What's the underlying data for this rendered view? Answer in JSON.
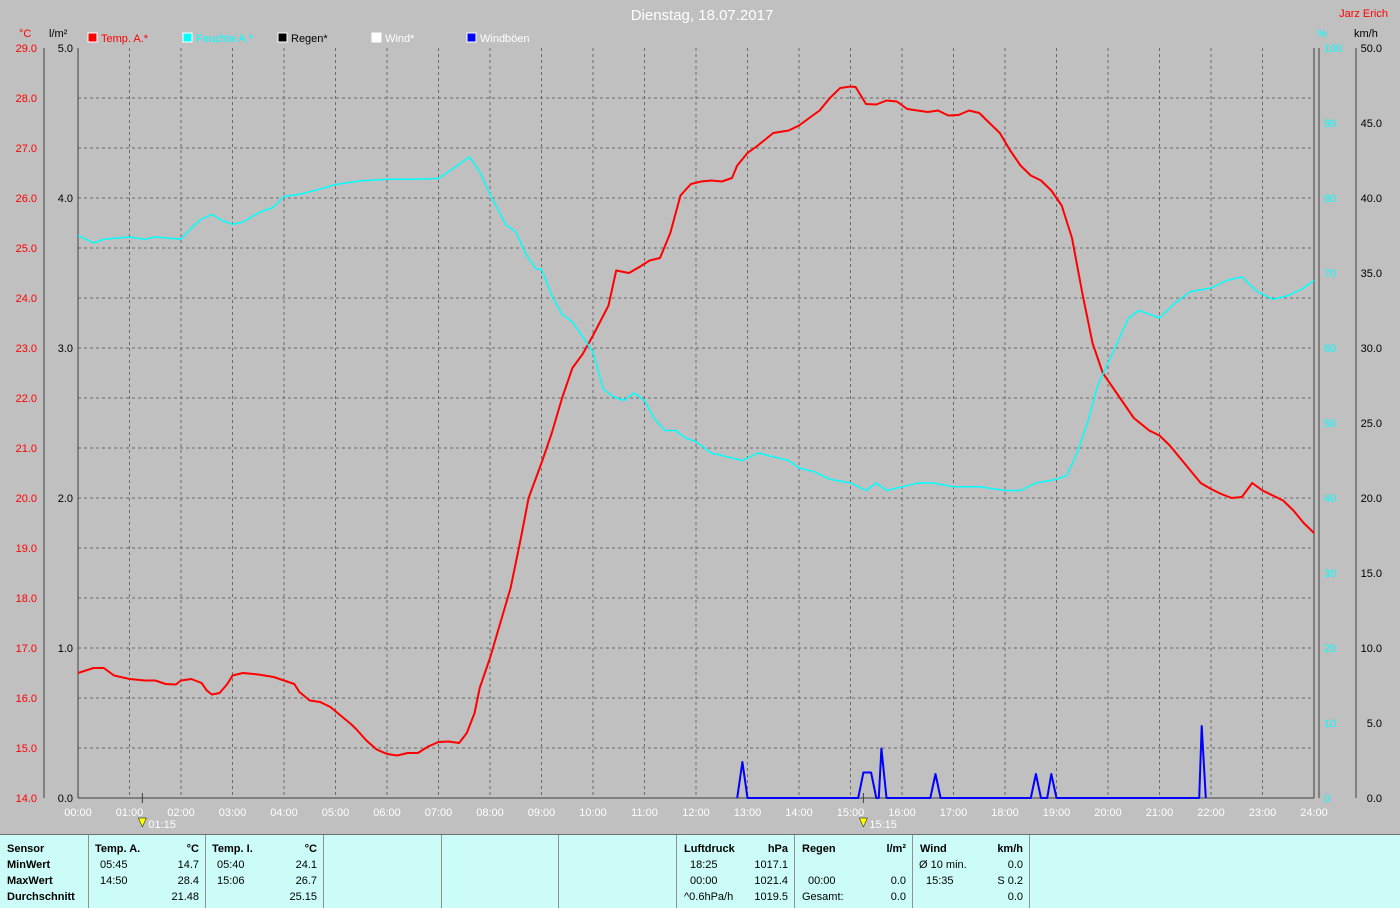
{
  "title": "Dienstag, 18.07.2017",
  "author": "Jarz Erich",
  "unit_labels": {
    "temp": "°C",
    "rain": "l/m²",
    "humidity": "%",
    "wind": "km/h"
  },
  "colors": {
    "temp": "#ff0000",
    "humidity": "#00ffff",
    "rain": "#000000",
    "wind": "#ffffff",
    "gust": "#0000ff"
  },
  "markers": [
    {
      "time": "01:15",
      "icon": "sun-icon"
    },
    {
      "time": "15:15",
      "icon": "sun-icon"
    }
  ],
  "chart_data": {
    "type": "line",
    "title": "Dienstag, 18.07.2017",
    "legend_position": "top",
    "grid": true,
    "x_ticks": [
      "00:00",
      "01:00",
      "02:00",
      "03:00",
      "04:00",
      "05:00",
      "06:00",
      "07:00",
      "08:00",
      "09:00",
      "10:00",
      "11:00",
      "12:00",
      "13:00",
      "14:00",
      "15:00",
      "16:00",
      "17:00",
      "18:00",
      "19:00",
      "20:00",
      "21:00",
      "22:00",
      "23:00",
      "24:00"
    ],
    "x_range_hours": [
      0,
      24
    ],
    "axes": {
      "temp": {
        "label": "°C",
        "range": [
          14.0,
          29.0
        ],
        "ticks": [
          "14.0",
          "15.0",
          "16.0",
          "17.0",
          "18.0",
          "19.0",
          "20.0",
          "21.0",
          "22.0",
          "23.0",
          "24.0",
          "25.0",
          "26.0",
          "27.0",
          "28.0",
          "29.0"
        ]
      },
      "rain": {
        "label": "l/m²",
        "range": [
          0.0,
          5.0
        ],
        "ticks": [
          "0.0",
          "1.0",
          "2.0",
          "3.0",
          "4.0",
          "5.0"
        ]
      },
      "humidity": {
        "label": "%",
        "range": [
          0,
          100
        ],
        "ticks": [
          "0",
          "10",
          "20",
          "30",
          "40",
          "50",
          "60",
          "70",
          "80",
          "90",
          "100"
        ]
      },
      "wind": {
        "label": "km/h",
        "range": [
          0.0,
          50.0
        ],
        "ticks": [
          "0.0",
          "5.0",
          "10.0",
          "15.0",
          "20.0",
          "25.0",
          "30.0",
          "35.0",
          "40.0",
          "45.0",
          "50.0"
        ]
      }
    },
    "series": [
      {
        "name": "Temp. A.*",
        "axis": "temp",
        "points": [
          [
            0,
            16.5
          ],
          [
            0.3,
            16.6
          ],
          [
            0.5,
            16.6
          ],
          [
            0.7,
            16.45
          ],
          [
            1,
            16.38
          ],
          [
            1.3,
            16.35
          ],
          [
            1.5,
            16.35
          ],
          [
            1.7,
            16.28
          ],
          [
            1.9,
            16.27
          ],
          [
            2,
            16.35
          ],
          [
            2.2,
            16.38
          ],
          [
            2.4,
            16.3
          ],
          [
            2.5,
            16.15
          ],
          [
            2.6,
            16.07
          ],
          [
            2.75,
            16.1
          ],
          [
            2.9,
            16.28
          ],
          [
            3,
            16.45
          ],
          [
            3.2,
            16.5
          ],
          [
            3.5,
            16.47
          ],
          [
            3.8,
            16.42
          ],
          [
            4,
            16.35
          ],
          [
            4.2,
            16.28
          ],
          [
            4.3,
            16.12
          ],
          [
            4.5,
            15.95
          ],
          [
            4.7,
            15.92
          ],
          [
            4.9,
            15.82
          ],
          [
            5.1,
            15.65
          ],
          [
            5.3,
            15.48
          ],
          [
            5.4,
            15.38
          ],
          [
            5.6,
            15.15
          ],
          [
            5.8,
            14.97
          ],
          [
            6,
            14.88
          ],
          [
            6.2,
            14.85
          ],
          [
            6.4,
            14.9
          ],
          [
            6.6,
            14.9
          ],
          [
            6.8,
            15.03
          ],
          [
            7,
            15.12
          ],
          [
            7.2,
            15.13
          ],
          [
            7.4,
            15.1
          ],
          [
            7.55,
            15.3
          ],
          [
            7.7,
            15.7
          ],
          [
            7.8,
            16.2
          ],
          [
            8,
            16.8
          ],
          [
            8.2,
            17.5
          ],
          [
            8.4,
            18.2
          ],
          [
            8.6,
            19.2
          ],
          [
            8.75,
            20.0
          ],
          [
            9,
            20.7
          ],
          [
            9.2,
            21.3
          ],
          [
            9.4,
            22.0
          ],
          [
            9.6,
            22.6
          ],
          [
            9.8,
            22.88
          ],
          [
            10,
            23.25
          ],
          [
            10.3,
            23.85
          ],
          [
            10.45,
            24.55
          ],
          [
            10.7,
            24.5
          ],
          [
            10.9,
            24.62
          ],
          [
            11.1,
            24.75
          ],
          [
            11.3,
            24.8
          ],
          [
            11.5,
            25.3
          ],
          [
            11.7,
            26.05
          ],
          [
            11.9,
            26.28
          ],
          [
            12.1,
            26.33
          ],
          [
            12.3,
            26.35
          ],
          [
            12.5,
            26.33
          ],
          [
            12.7,
            26.4
          ],
          [
            12.8,
            26.65
          ],
          [
            13,
            26.9
          ],
          [
            13.2,
            27.05
          ],
          [
            13.5,
            27.3
          ],
          [
            13.8,
            27.35
          ],
          [
            14,
            27.45
          ],
          [
            14.2,
            27.6
          ],
          [
            14.4,
            27.75
          ],
          [
            14.6,
            28.0
          ],
          [
            14.8,
            28.2
          ],
          [
            15,
            28.23
          ],
          [
            15.1,
            28.22
          ],
          [
            15.3,
            27.88
          ],
          [
            15.5,
            27.87
          ],
          [
            15.7,
            27.95
          ],
          [
            15.9,
            27.93
          ],
          [
            16.1,
            27.78
          ],
          [
            16.3,
            27.75
          ],
          [
            16.5,
            27.72
          ],
          [
            16.7,
            27.75
          ],
          [
            16.9,
            27.65
          ],
          [
            17.1,
            27.66
          ],
          [
            17.3,
            27.75
          ],
          [
            17.5,
            27.7
          ],
          [
            17.7,
            27.5
          ],
          [
            17.9,
            27.3
          ],
          [
            18.1,
            26.95
          ],
          [
            18.3,
            26.65
          ],
          [
            18.5,
            26.45
          ],
          [
            18.7,
            26.35
          ],
          [
            18.9,
            26.15
          ],
          [
            19.1,
            25.85
          ],
          [
            19.3,
            25.2
          ],
          [
            19.5,
            24.1
          ],
          [
            19.7,
            23.1
          ],
          [
            19.9,
            22.5
          ],
          [
            20.2,
            22.05
          ],
          [
            20.5,
            21.6
          ],
          [
            20.8,
            21.35
          ],
          [
            21,
            21.25
          ],
          [
            21.2,
            21.05
          ],
          [
            21.4,
            20.8
          ],
          [
            21.6,
            20.55
          ],
          [
            21.8,
            20.3
          ],
          [
            22,
            20.18
          ],
          [
            22.2,
            20.08
          ],
          [
            22.4,
            20.0
          ],
          [
            22.6,
            20.02
          ],
          [
            22.8,
            20.3
          ],
          [
            23,
            20.15
          ],
          [
            23.2,
            20.05
          ],
          [
            23.4,
            19.95
          ],
          [
            23.6,
            19.75
          ],
          [
            23.8,
            19.5
          ],
          [
            24,
            19.3
          ]
        ]
      },
      {
        "name": "Feuchte A.*",
        "axis": "humidity",
        "points": [
          [
            0,
            75
          ],
          [
            0.3,
            74
          ],
          [
            0.5,
            74.5
          ],
          [
            1,
            74.8
          ],
          [
            1.3,
            74.5
          ],
          [
            1.5,
            74.8
          ],
          [
            2,
            74.5
          ],
          [
            2.2,
            76
          ],
          [
            2.4,
            77.2
          ],
          [
            2.6,
            77.8
          ],
          [
            2.8,
            77
          ],
          [
            3,
            76.5
          ],
          [
            3.2,
            76.8
          ],
          [
            3.5,
            78
          ],
          [
            3.8,
            78.8
          ],
          [
            4,
            80.2
          ],
          [
            4.3,
            80.5
          ],
          [
            4.6,
            81
          ],
          [
            5,
            81.8
          ],
          [
            5.5,
            82.3
          ],
          [
            6,
            82.5
          ],
          [
            6.5,
            82.5
          ],
          [
            7,
            82.6
          ],
          [
            7.3,
            84
          ],
          [
            7.5,
            85
          ],
          [
            7.6,
            85.5
          ],
          [
            7.8,
            83.5
          ],
          [
            8,
            80.5
          ],
          [
            8.3,
            76.5
          ],
          [
            8.5,
            75.5
          ],
          [
            8.7,
            72.5
          ],
          [
            8.9,
            70.5
          ],
          [
            9,
            70.5
          ],
          [
            9.2,
            67
          ],
          [
            9.4,
            64.5
          ],
          [
            9.6,
            63.5
          ],
          [
            9.8,
            61.5
          ],
          [
            10,
            59.5
          ],
          [
            10.2,
            54.5
          ],
          [
            10.4,
            53.5
          ],
          [
            10.6,
            53
          ],
          [
            10.8,
            54
          ],
          [
            11,
            53
          ],
          [
            11.2,
            50.5
          ],
          [
            11.4,
            49
          ],
          [
            11.6,
            49
          ],
          [
            11.8,
            48
          ],
          [
            12,
            47.5
          ],
          [
            12.3,
            46
          ],
          [
            12.6,
            45.5
          ],
          [
            12.9,
            45
          ],
          [
            13.2,
            46
          ],
          [
            13.5,
            45.5
          ],
          [
            13.8,
            45
          ],
          [
            14,
            44
          ],
          [
            14.3,
            43.5
          ],
          [
            14.6,
            42.5
          ],
          [
            15,
            42
          ],
          [
            15.3,
            41
          ],
          [
            15.5,
            42
          ],
          [
            15.7,
            41
          ],
          [
            16,
            41.5
          ],
          [
            16.3,
            42
          ],
          [
            16.6,
            42
          ],
          [
            17,
            41.5
          ],
          [
            17.5,
            41.5
          ],
          [
            18,
            41
          ],
          [
            18.3,
            41
          ],
          [
            18.6,
            42
          ],
          [
            19,
            42.5
          ],
          [
            19.2,
            43
          ],
          [
            19.4,
            46
          ],
          [
            19.6,
            50
          ],
          [
            19.8,
            55
          ],
          [
            20,
            58
          ],
          [
            20.2,
            61
          ],
          [
            20.4,
            64
          ],
          [
            20.6,
            65
          ],
          [
            21,
            64
          ],
          [
            21.3,
            66
          ],
          [
            21.6,
            67.5
          ],
          [
            22,
            68
          ],
          [
            22.3,
            69
          ],
          [
            22.6,
            69.5
          ],
          [
            22.9,
            67.5
          ],
          [
            23.2,
            66.5
          ],
          [
            23.5,
            67
          ],
          [
            23.8,
            68
          ],
          [
            24,
            69
          ]
        ]
      },
      {
        "name": "Regen*",
        "axis": "rain",
        "points": []
      },
      {
        "name": "Wind*",
        "axis": "wind",
        "points": []
      },
      {
        "name": "Windböen",
        "axis": "wind",
        "points": [
          [
            12.8,
            0
          ],
          [
            12.9,
            2.4
          ],
          [
            13.0,
            0
          ],
          [
            15.15,
            0
          ],
          [
            15.25,
            1.7
          ],
          [
            15.4,
            1.7
          ],
          [
            15.5,
            0
          ],
          [
            15.55,
            0
          ],
          [
            15.6,
            3.3
          ],
          [
            15.7,
            0
          ],
          [
            16.55,
            0
          ],
          [
            16.65,
            1.6
          ],
          [
            16.75,
            0
          ],
          [
            18.5,
            0
          ],
          [
            18.6,
            1.6
          ],
          [
            18.7,
            0
          ],
          [
            18.82,
            0
          ],
          [
            18.9,
            1.6
          ],
          [
            19.0,
            0
          ],
          [
            21.77,
            0
          ],
          [
            21.82,
            4.8
          ],
          [
            21.9,
            0
          ]
        ]
      }
    ]
  },
  "panel": {
    "sensor": {
      "header": "Sensor",
      "rows": [
        "MinWert",
        "MaxWert",
        "Durchschnitt"
      ]
    },
    "temp_a": {
      "header": "Temp. A.",
      "unit": "°C",
      "min_time": "05:45",
      "min_val": "14.7",
      "max_time": "14:50",
      "max_val": "28.4",
      "avg": "21.48"
    },
    "temp_i": {
      "header": "Temp. I.",
      "unit": "°C",
      "min_time": "05:40",
      "min_val": "24.1",
      "max_time": "15:06",
      "max_val": "26.7",
      "avg": "25.15"
    },
    "pressure": {
      "header": "Luftdruck",
      "unit": "hPa",
      "r1_label": "18:25",
      "r1_val": "1017.1",
      "r2_label": "00:00",
      "r2_val": "1021.4",
      "r3_label": "^0.6hPa/h",
      "r3_val": "1019.5"
    },
    "rain": {
      "header": "Regen",
      "unit": "l/m²",
      "r2_label": "00:00",
      "r2_val": "0.0",
      "r3_label": "Gesamt:",
      "r3_val": "0.0"
    },
    "wind": {
      "header": "Wind",
      "unit": "km/h",
      "r1_label": "Ø 10 min.",
      "r1_val": "0.0",
      "r2_label": "15:35",
      "r2_val": "S 0.2",
      "r3_val": "0.0"
    }
  }
}
